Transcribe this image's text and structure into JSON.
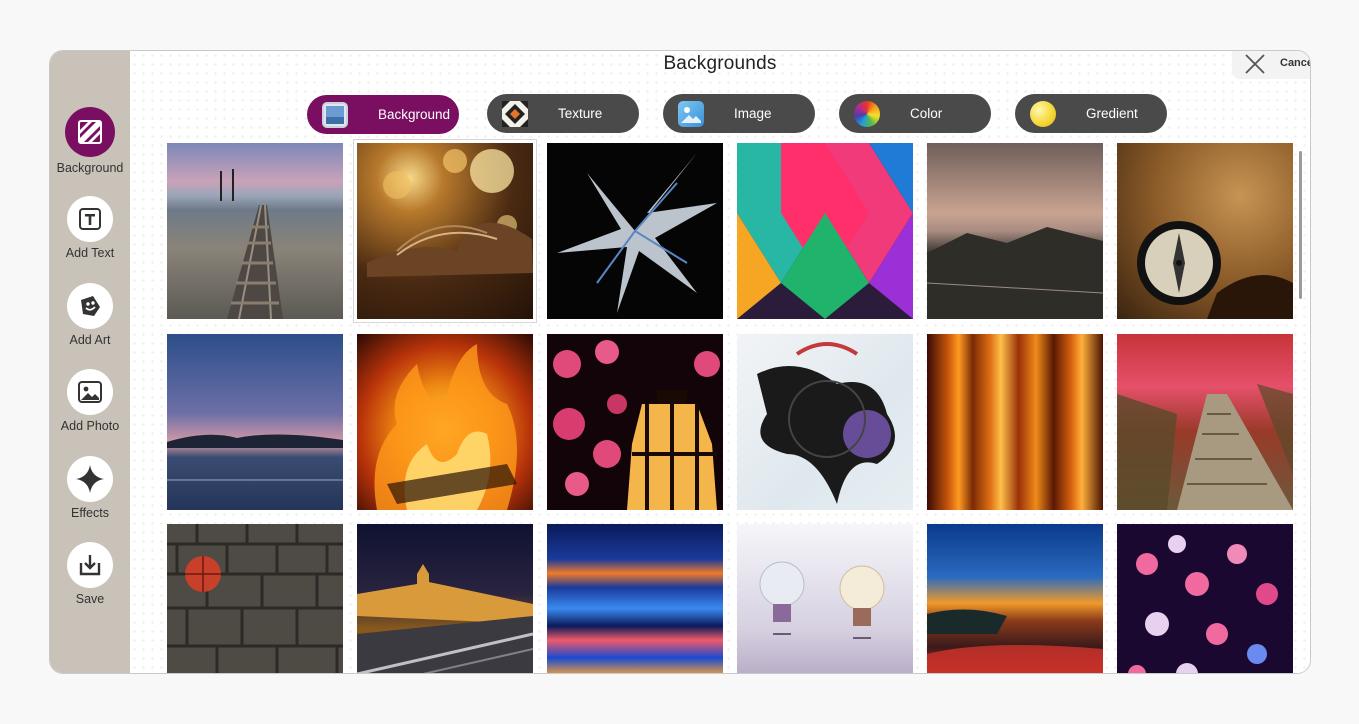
{
  "header": {
    "title": "Backgrounds",
    "cancel_label": "Cancel"
  },
  "sidebar": {
    "items": [
      {
        "label": "Background",
        "icon": "background-icon",
        "active": true
      },
      {
        "label": "Add Text",
        "icon": "text-icon"
      },
      {
        "label": "Add Art",
        "icon": "sticker-icon"
      },
      {
        "label": "Add Photo",
        "icon": "photo-icon"
      },
      {
        "label": "Effects",
        "icon": "sparkle-icon"
      },
      {
        "label": "Save",
        "icon": "download-icon"
      }
    ]
  },
  "tabs": [
    {
      "label": "Background",
      "icon": "background-thumbnail-icon",
      "active": true
    },
    {
      "label": "Texture",
      "icon": "texture-pattern-icon"
    },
    {
      "label": "Image",
      "icon": "image-icon"
    },
    {
      "label": "Color",
      "icon": "color-wheel-icon"
    },
    {
      "label": "Gredient",
      "icon": "gradient-circle-icon"
    }
  ],
  "gallery": {
    "thumbnails": [
      "railway-tracks-at-dusk",
      "open-book-bokeh",
      "white-abstract-burst-on-black",
      "colorful-diamond-pattern",
      "mountain-valley-sunset",
      "compass-on-old-map",
      "lake-at-twilight",
      "fire-flames",
      "lantern-with-pink-bokeh",
      "abstract-ink-splash-art",
      "orange-light-streaks",
      "red-forest-boardwalk",
      "basketball-on-cobblestones",
      "parliament-at-night",
      "blue-light-streaks",
      "light-bulbs",
      "coastal-sunset-flowers",
      "pink-blue-bokeh-lights"
    ],
    "selected_index": 1
  },
  "colors": {
    "accent": "#7a0f62",
    "tab_inactive": "#4a4a4a",
    "sidebar": "#c8c2b8"
  }
}
